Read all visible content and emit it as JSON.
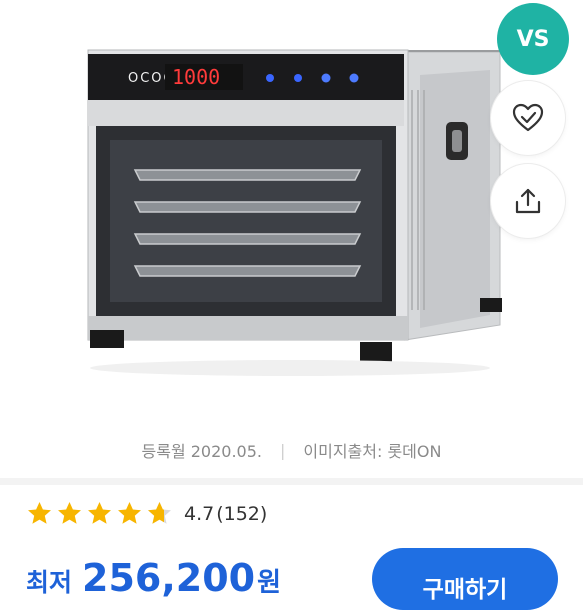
{
  "vs_button": {
    "label": "VS",
    "color": "#1fb3a4"
  },
  "product": {
    "brand": "OCOO",
    "display_text": "1000",
    "registered_label": "등록월 2020.05.",
    "image_source_label": "이미지출처: 롯데ON"
  },
  "rating": {
    "value": "4.7",
    "count": "(152)",
    "stars": 4.7
  },
  "price": {
    "label": "최저",
    "value": "256,200",
    "unit": "원"
  },
  "buy_button": {
    "label": "구매하기",
    "color": "#1f6fe3"
  },
  "icons": {
    "like": "heart-check-icon",
    "share": "share-icon"
  }
}
